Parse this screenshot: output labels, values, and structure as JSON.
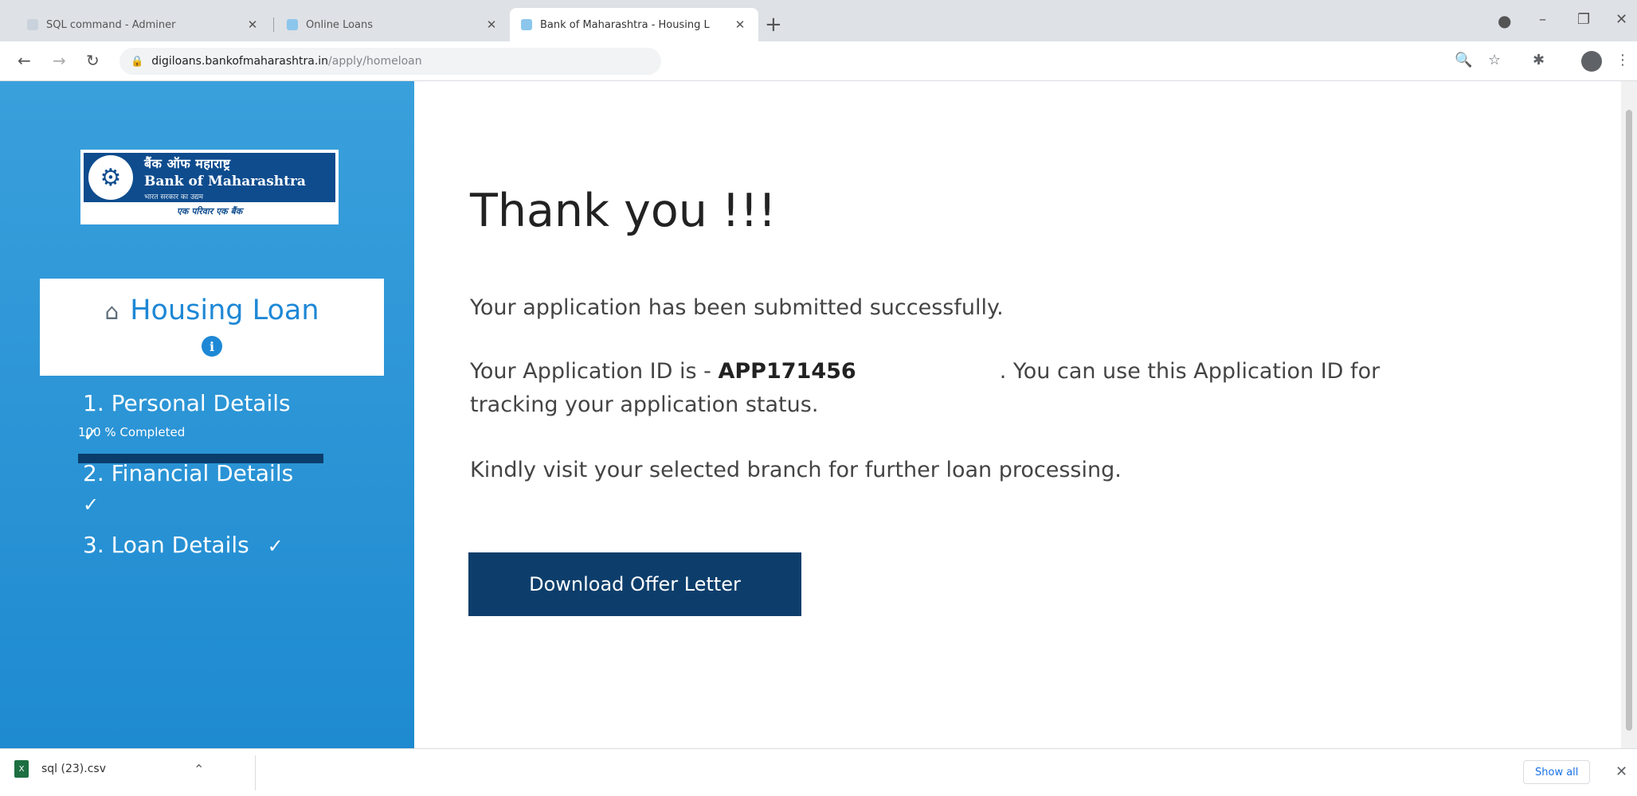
{
  "browser": {
    "tabs": [
      {
        "label": "SQL command - Adminer",
        "active": false
      },
      {
        "label": "Online Loans",
        "active": false
      },
      {
        "label": "Bank of Maharashtra - Housing L",
        "active": true
      }
    ],
    "url_host": "digiloans.bankofmaharashtra.in",
    "url_path": "/apply/homeloan"
  },
  "sidebar": {
    "logo": {
      "hindi_name": "बैंक ऑफ महाराष्ट्र",
      "english_name": "Bank of Maharashtra",
      "tagline": "भारत सरकार का उद्यम",
      "slogan": "एक परिवार एक बैंक"
    },
    "loan_type": "Housing Loan",
    "progress": {
      "label": "100 % Completed",
      "percent": 100
    },
    "steps": [
      {
        "label": "1. Personal Details",
        "completed": true
      },
      {
        "label": "2. Financial Details",
        "completed": true
      },
      {
        "label": "3. Loan Details",
        "completed": true
      }
    ]
  },
  "main": {
    "heading": "Thank you !!!",
    "submitted_msg": "Your application has been submitted successfully.",
    "appid_prefix": "Your Application ID is - ",
    "application_id": "APP171456",
    "appid_suffix": ". You can use this Application ID for",
    "appid_line2": "tracking your application status.",
    "branch_msg": "Kindly visit your selected branch for further loan processing.",
    "download_button": "Download Offer Letter"
  },
  "download_bar": {
    "file_name": "sql (23).csv",
    "show_all": "Show all"
  },
  "colors": {
    "sidebar_blue": "#2596d8",
    "accent_blue": "#1e88d6",
    "dark_navy": "#0d3e6b"
  }
}
